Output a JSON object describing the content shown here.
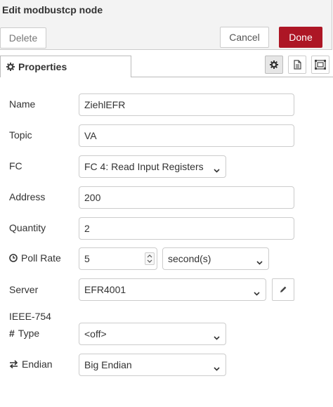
{
  "dialog": {
    "title": "Edit modbustcp node",
    "delete_label": "Delete",
    "cancel_label": "Cancel",
    "done_label": "Done",
    "accent_color": "#ad1625"
  },
  "tabs": {
    "active_label": "Properties",
    "icons": [
      "gear-icon",
      "description-icon",
      "appearance-icon"
    ]
  },
  "form": {
    "name": {
      "label": "Name",
      "value": "ZiehlEFR"
    },
    "topic": {
      "label": "Topic",
      "value": "VA"
    },
    "fc": {
      "label": "FC",
      "value": "FC 4: Read Input Registers"
    },
    "address": {
      "label": "Address",
      "value": "200"
    },
    "quantity": {
      "label": "Quantity",
      "value": "2"
    },
    "poll_rate": {
      "label": "Poll Rate",
      "value": "5",
      "unit": "second(s)"
    },
    "server": {
      "label": "Server",
      "value": "EFR4001"
    },
    "ieee_section": "IEEE-754",
    "type": {
      "label": "Type",
      "value": "<off>"
    },
    "endian": {
      "label": "Endian",
      "value": "Big Endian"
    }
  }
}
